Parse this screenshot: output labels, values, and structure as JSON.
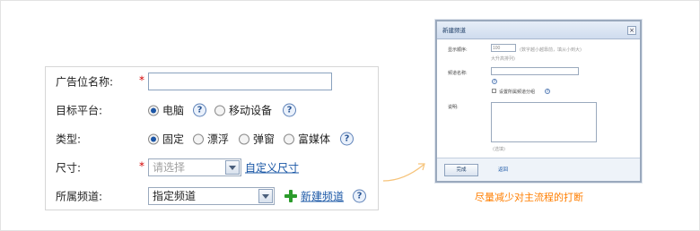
{
  "form": {
    "name": {
      "label": "广告位名称:",
      "required_mark": "*",
      "value": ""
    },
    "platform": {
      "label": "目标平台:",
      "options": [
        "电脑",
        "移动设备"
      ],
      "selected": "电脑",
      "help": "?"
    },
    "type": {
      "label": "类型:",
      "options": [
        "固定",
        "漂浮",
        "弹窗",
        "富媒体"
      ],
      "selected": "固定",
      "help": "?"
    },
    "size": {
      "label": "尺寸:",
      "required_mark": "*",
      "placeholder": "请选择",
      "custom_link": "自定义尺寸"
    },
    "channel": {
      "label": "所属频道:",
      "value": "指定频道",
      "new_link": "新建频道",
      "help": "?"
    }
  },
  "dialog": {
    "title": "新建频道",
    "close": "×",
    "order_label": "显示顺序:",
    "order_value": "100",
    "order_hint": "(数字越小越靠前，填从小到大)",
    "order_hint2": "大升高排列)",
    "name_label": "频道名称:",
    "name_value": "",
    "help": "?",
    "checkbox_label": "设置所属频道分组",
    "desc_label": "说明:",
    "desc_hint": "(选填)",
    "ok_button": "完成",
    "back_link": "返回"
  },
  "caption": "尽量减少对主流程的打断",
  "colors": {
    "accent_link": "#1a57a6",
    "required": "#d40000",
    "caption": "#ff7e00",
    "plus": "#2b9b2b"
  }
}
